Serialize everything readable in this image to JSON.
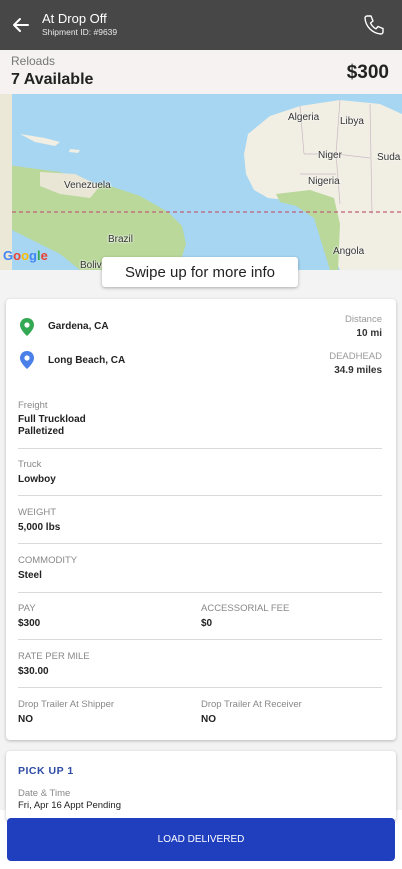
{
  "header": {
    "title": "At Drop Off",
    "subtitle": "Shipment ID: #9639",
    "back_icon": "arrow-left-icon",
    "phone_icon": "phone-icon"
  },
  "reloads": {
    "label": "Reloads",
    "count": "7 Available",
    "price": "$300"
  },
  "map": {
    "labels": [
      "Algeria",
      "Libya",
      "Niger",
      "Suda",
      "Nigeria",
      "Venezuela",
      "Brazil",
      "Angola",
      "Bolivi"
    ],
    "attribution": [
      "G",
      "o",
      "o",
      "g",
      "l",
      "e"
    ],
    "colors": {
      "water": "#a6d6f1",
      "land": "#f1eee4",
      "green": "#b9d89a",
      "route": "#c0607a"
    }
  },
  "swipe_hint": "Swipe up for more info",
  "details": {
    "origin": "Gardena, CA",
    "destination": "Long Beach, CA",
    "distance_label": "Distance",
    "distance_value": "10  mi",
    "deadhead_label": "DEADHEAD",
    "deadhead_value": "34.9 miles",
    "freight_label": "Freight",
    "freight_value_1": "Full Truckload",
    "freight_value_2": "Palletized",
    "truck_label": "Truck",
    "truck_value": "Lowboy",
    "weight_label": "WEIGHT",
    "weight_value": "5,000  lbs",
    "commodity_label": "COMMODITY",
    "commodity_value": "Steel",
    "pay_label": "PAY",
    "pay_value": "$300",
    "accessorial_label": "ACCESSORIAL FEE",
    "accessorial_value": "$0",
    "rpm_label": "RATE PER MILE",
    "rpm_value": "$30.00",
    "drop_shipper_label": "Drop Trailer At Shipper",
    "drop_shipper_value": "NO",
    "drop_receiver_label": "Drop Trailer At Receiver",
    "drop_receiver_value": "NO",
    "origin_pin_color": "#34a853",
    "destination_pin_color": "#4a80e8"
  },
  "pickup": {
    "title": "PICK UP 1",
    "datetime_label": "Date & Time",
    "datetime_value": "Fri, Apr 16 Appt Pending"
  },
  "action": {
    "label": "LOAD DELIVERED",
    "color": "#1f3fbf"
  }
}
